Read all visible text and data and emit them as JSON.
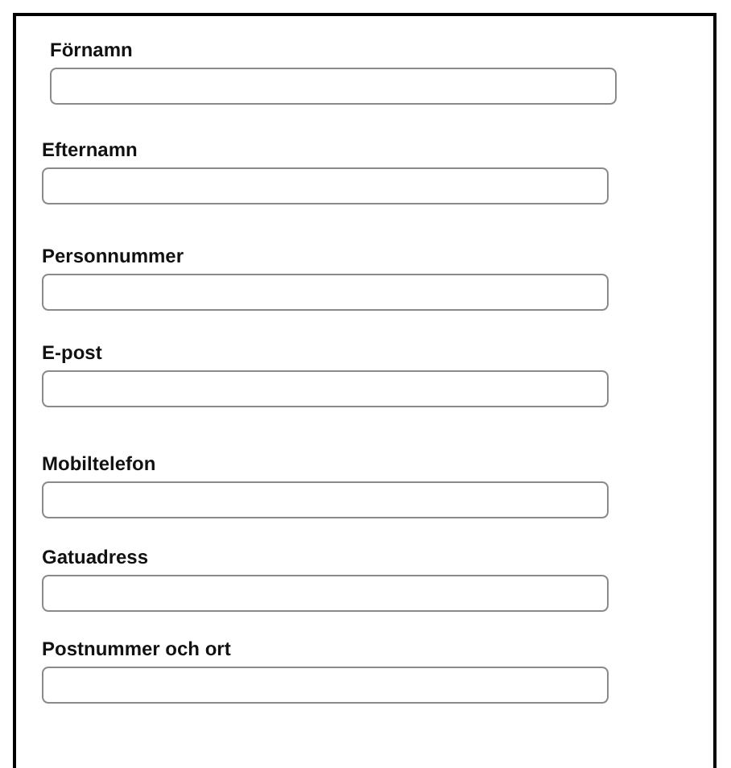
{
  "fields": [
    {
      "label": "Förnamn"
    },
    {
      "label": "Efternamn"
    },
    {
      "label": "Personnummer"
    },
    {
      "label": "E-post"
    },
    {
      "label": "Mobiltelefon"
    },
    {
      "label": "Gatuadress"
    },
    {
      "label": "Postnummer och ort"
    }
  ]
}
